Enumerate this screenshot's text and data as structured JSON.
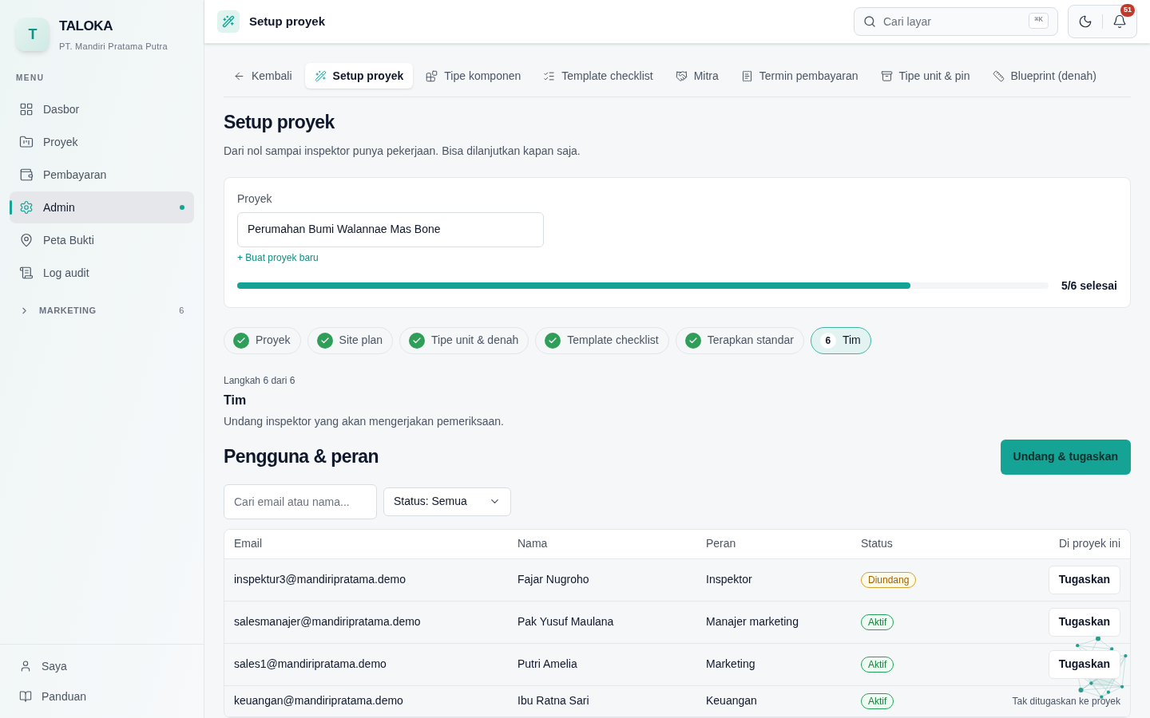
{
  "brand": {
    "logo_letter": "T",
    "name": "TALOKA",
    "company": "PT. Mandiri Pratama Putra"
  },
  "sidebar": {
    "section_label": "MENU",
    "items": [
      {
        "label": "Dasbor",
        "selected": false
      },
      {
        "label": "Proyek",
        "selected": false
      },
      {
        "label": "Pembayaran",
        "selected": false
      },
      {
        "label": "Admin",
        "selected": true
      },
      {
        "label": "Peta Bukti",
        "selected": false
      },
      {
        "label": "Log audit",
        "selected": false
      }
    ],
    "group": {
      "label": "MARKETING",
      "count": "6",
      "expanded": false
    },
    "footer_items": [
      {
        "label": "Saya"
      },
      {
        "label": "Panduan"
      }
    ]
  },
  "header": {
    "title": "Setup proyek",
    "search_placeholder": "Cari layar",
    "shortcut": "⌘K",
    "notification_count": "51"
  },
  "tabs": [
    {
      "label": "Kembali",
      "selected": false
    },
    {
      "label": "Setup proyek",
      "selected": true
    },
    {
      "label": "Tipe komponen",
      "selected": false
    },
    {
      "label": "Template checklist",
      "selected": false
    },
    {
      "label": "Mitra",
      "selected": false
    },
    {
      "label": "Termin pembayaran",
      "selected": false
    },
    {
      "label": "Tipe unit & pin",
      "selected": false
    },
    {
      "label": "Blueprint (denah)",
      "selected": false
    }
  ],
  "page": {
    "title": "Setup proyek",
    "subtitle": "Dari nol sampai inspektor punya pekerjaan. Bisa dilanjutkan kapan saja."
  },
  "project_card": {
    "label": "Proyek",
    "value": "Perumahan Bumi Walannae Mas Bone",
    "new_link": "+ Buat proyek baru",
    "progress": {
      "level": 0.83,
      "reading": "5/6 selesai"
    }
  },
  "steps": [
    {
      "label": "Proyek",
      "done": true,
      "selected": false
    },
    {
      "label": "Site plan",
      "done": true,
      "selected": false
    },
    {
      "label": "Tipe unit & denah",
      "done": true,
      "selected": false
    },
    {
      "label": "Template checklist",
      "done": true,
      "selected": false
    },
    {
      "label": "Terapkan standar",
      "done": true,
      "selected": false
    },
    {
      "label": "Tim",
      "number": "6",
      "done": false,
      "selected": true
    }
  ],
  "step_info": {
    "counter": "Langkah 6 dari 6",
    "title": "Tim",
    "description": "Undang inspektor yang akan mengerjakan pemeriksaan."
  },
  "users": {
    "title": "Pengguna & peran",
    "invite_button": "Undang & tugaskan",
    "search_placeholder": "Cari email atau nama...",
    "status_filter": "Status: Semua",
    "columns": [
      "Email",
      "Nama",
      "Peran",
      "Status",
      "Di proyek ini"
    ],
    "rows": [
      {
        "email": "inspektur3@mandiripratama.demo",
        "name": "Fajar Nugroho",
        "role": "Inspektor",
        "status": {
          "label": "Diundang",
          "kind": "invited"
        },
        "action": {
          "kind": "button",
          "label": "Tugaskan"
        }
      },
      {
        "email": "salesmanajer@mandiripratama.demo",
        "name": "Pak Yusuf Maulana",
        "role": "Manajer marketing",
        "status": {
          "label": "Aktif",
          "kind": "active"
        },
        "action": {
          "kind": "button",
          "label": "Tugaskan"
        }
      },
      {
        "email": "sales1@mandiripratama.demo",
        "name": "Putri Amelia",
        "role": "Marketing",
        "status": {
          "label": "Aktif",
          "kind": "active"
        },
        "action": {
          "kind": "button",
          "label": "Tugaskan"
        }
      },
      {
        "email": "keuangan@mandiripratama.demo",
        "name": "Ibu Ratna Sari",
        "role": "Keuangan",
        "status": {
          "label": "Aktif",
          "kind": "active"
        },
        "action": {
          "kind": "text",
          "label": "Tak ditugaskan ke proyek"
        }
      }
    ]
  }
}
